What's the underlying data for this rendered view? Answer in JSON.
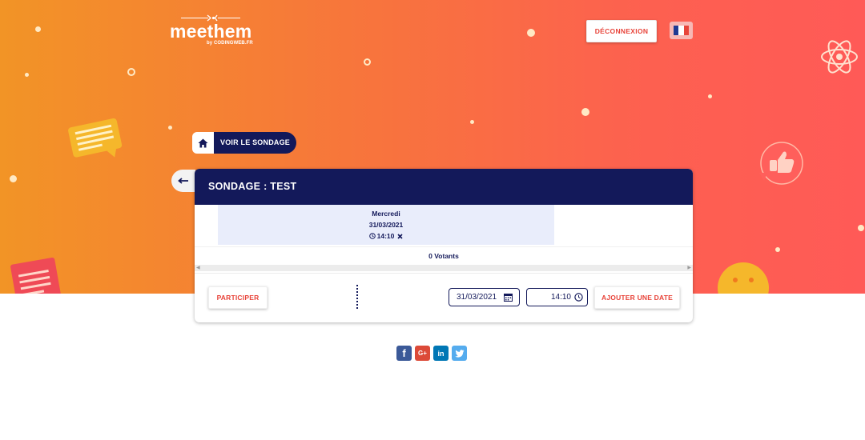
{
  "header": {
    "logo_word": "meethem",
    "logo_sub": "by CODINGWEB.FR",
    "logout_label": "DÉCONNEXION",
    "flag_icon": "french-flag"
  },
  "breadcrumb": {
    "label": "VOIR LE SONDAGE",
    "icon": "home-icon"
  },
  "poll": {
    "title": "SONDAGE : TEST",
    "date_column": {
      "day": "Mercredi",
      "date": "31/03/2021",
      "time": "14:10"
    },
    "votants": "0 Votants",
    "participate_label": "PARTICIPER",
    "date_input_value": "31/03/2021",
    "time_input_value": "14:10",
    "add_date_label": "AJOUTER UNE DATE"
  },
  "socials": [
    "facebook-icon",
    "google-plus-icon",
    "linkedin-icon",
    "twitter-icon"
  ],
  "colors": {
    "navy": "#13195a",
    "accent_red": "#e8443a",
    "gradient_start": "#f29426",
    "gradient_end": "#ff5a57"
  }
}
